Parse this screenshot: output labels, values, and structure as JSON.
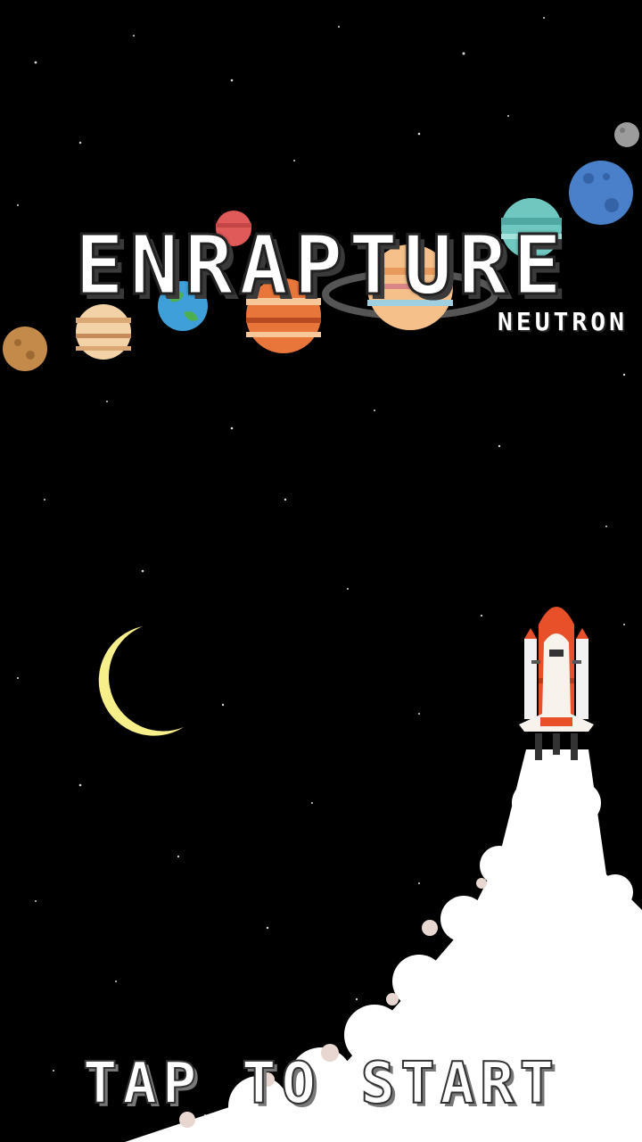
{
  "game": {
    "title": "ENRAPTURE",
    "subtitle": "NEUTRON",
    "prompt": "TAP TO START"
  },
  "colors": {
    "background": "#000000",
    "moon": "#f7f08a",
    "rocket_nose": "#e8502a",
    "smoke": "#ffffff",
    "earth": "#3f9fd8",
    "neptune": "#4a7fc9"
  },
  "icons": [
    "star-icon",
    "planet-icon",
    "moon-icon",
    "rocket-icon"
  ]
}
